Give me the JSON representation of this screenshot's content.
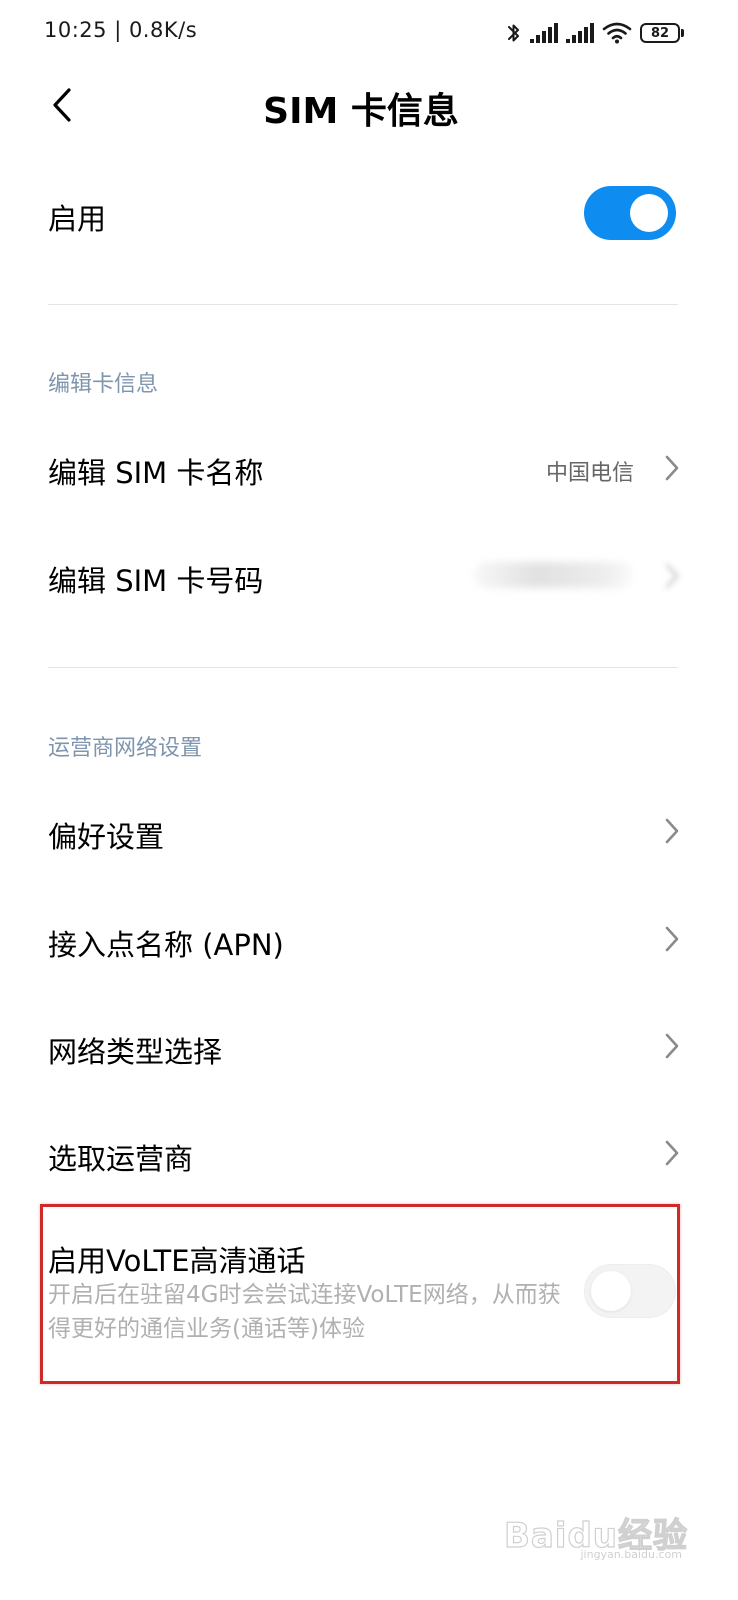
{
  "status_bar": {
    "time": "10:25 | 0.8K/s",
    "battery_level": "82",
    "icons": [
      "bluetooth-icon",
      "signal-icon",
      "signal-icon",
      "wifi-icon",
      "battery-icon"
    ]
  },
  "header": {
    "title": "SIM 卡信息",
    "back_icon": "chevron-left-icon"
  },
  "enable_row": {
    "label": "启用",
    "toggle_on": true,
    "accent_color": "#0f8cf0"
  },
  "section_edit": {
    "header": "编辑卡信息",
    "items": [
      {
        "label": "编辑 SIM 卡名称",
        "value": "中国电信"
      },
      {
        "label": "编辑 SIM 卡号码",
        "value": ""
      }
    ]
  },
  "section_network": {
    "header": "运营商网络设置",
    "items": [
      {
        "label": "偏好设置"
      },
      {
        "label": "接入点名称 (APN)"
      },
      {
        "label": "网络类型选择"
      },
      {
        "label": "选取运营商"
      }
    ]
  },
  "volte": {
    "title": "启用VoLTE高清通话",
    "description": "开启后在驻留4G时会尝试连接VoLTE网络，从而获得更好的通信业务(通话等)体验",
    "toggle_on": false,
    "highlight_color": "#cf2a2a"
  },
  "watermark": {
    "text": "Baidu经验",
    "url": "jingyan.baidu.com"
  }
}
